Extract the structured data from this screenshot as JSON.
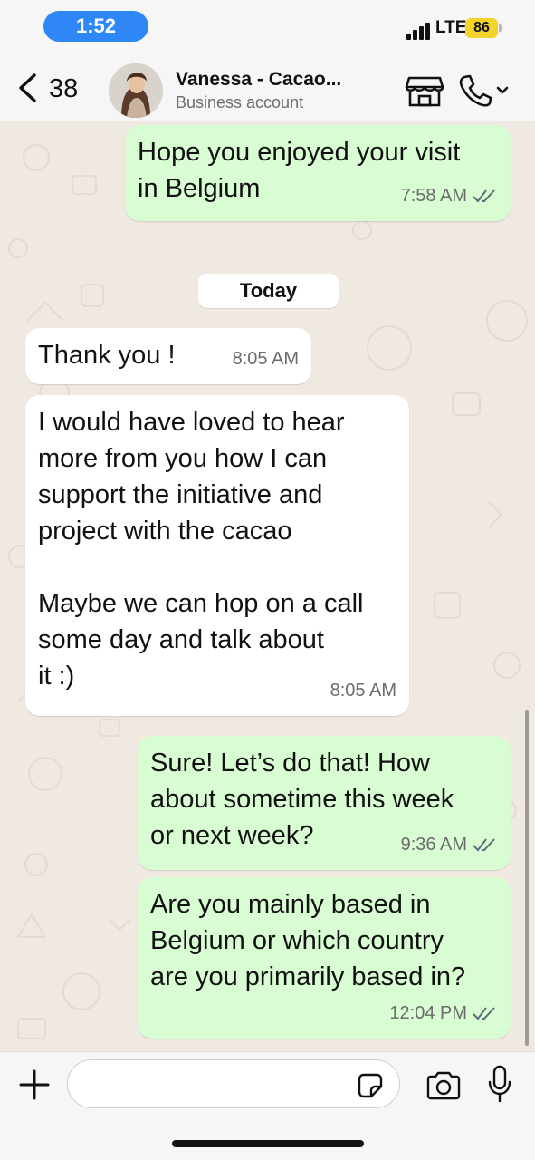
{
  "status_bar": {
    "time": "1:52",
    "network": "LTE",
    "battery": "86",
    "time_pill_color": "#2f86f6",
    "battery_color": "#f2d42c"
  },
  "header": {
    "back_count": "38",
    "contact_name": "Vanessa - Cacao...",
    "contact_subtitle": "Business account",
    "icons": [
      "chevron-left-icon",
      "avatar",
      "store-icon",
      "phone-icon",
      "chevron-down-icon"
    ]
  },
  "chat": {
    "date_separator": "Today",
    "colors": {
      "outgoing": "#d9fdd3",
      "incoming": "#ffffff",
      "wallpaper": "#efe9e1",
      "read_ticks": "#5c6d78"
    },
    "messages": [
      {
        "direction": "out",
        "text": "Hope you enjoyed your visit\nin Belgium",
        "time": "7:58 AM",
        "status": "read"
      },
      {
        "direction": "in",
        "text": "Thank you !",
        "time": "8:05 AM"
      },
      {
        "direction": "in",
        "text": "I would have loved to hear\nmore from you how I can\nsupport the initiative and\nproject with the cacao\n\nMaybe we can hop on a call\nsome day and talk about\nit :)",
        "time": "8:05 AM"
      },
      {
        "direction": "out",
        "text": "Sure! Let’s do that! How\nabout sometime this week\nor next week?",
        "time": "9:36 AM",
        "status": "read"
      },
      {
        "direction": "out",
        "text": "Are you mainly based in\nBelgium or which country\nare you primarily based in?",
        "time": "12:04 PM",
        "status": "read"
      }
    ]
  },
  "composer": {
    "placeholder": "",
    "icons": [
      "plus-icon",
      "sticker-icon",
      "camera-icon",
      "microphone-icon"
    ]
  }
}
